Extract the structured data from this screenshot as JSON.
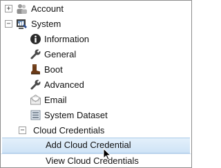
{
  "tree": {
    "items": [
      {
        "label": "Account",
        "toggle": "+",
        "icon": "users-icon"
      },
      {
        "label": "System",
        "toggle": "−",
        "icon": "system-monitor-icon"
      },
      {
        "label": "Information",
        "icon": "info-icon"
      },
      {
        "label": "General",
        "icon": "wrench-icon"
      },
      {
        "label": "Boot",
        "icon": "boot-icon"
      },
      {
        "label": "Advanced",
        "icon": "wrench-icon"
      },
      {
        "label": "Email",
        "icon": "email-icon"
      },
      {
        "label": "System Dataset",
        "icon": "dataset-icon"
      },
      {
        "label": "Cloud Credentials",
        "toggle": "−"
      },
      {
        "label": "Add Cloud Credential",
        "selected": true
      },
      {
        "label": "View Cloud Credentials"
      }
    ]
  },
  "colors": {
    "selection": "#cfe3f6",
    "border": "#8c8c8c"
  }
}
